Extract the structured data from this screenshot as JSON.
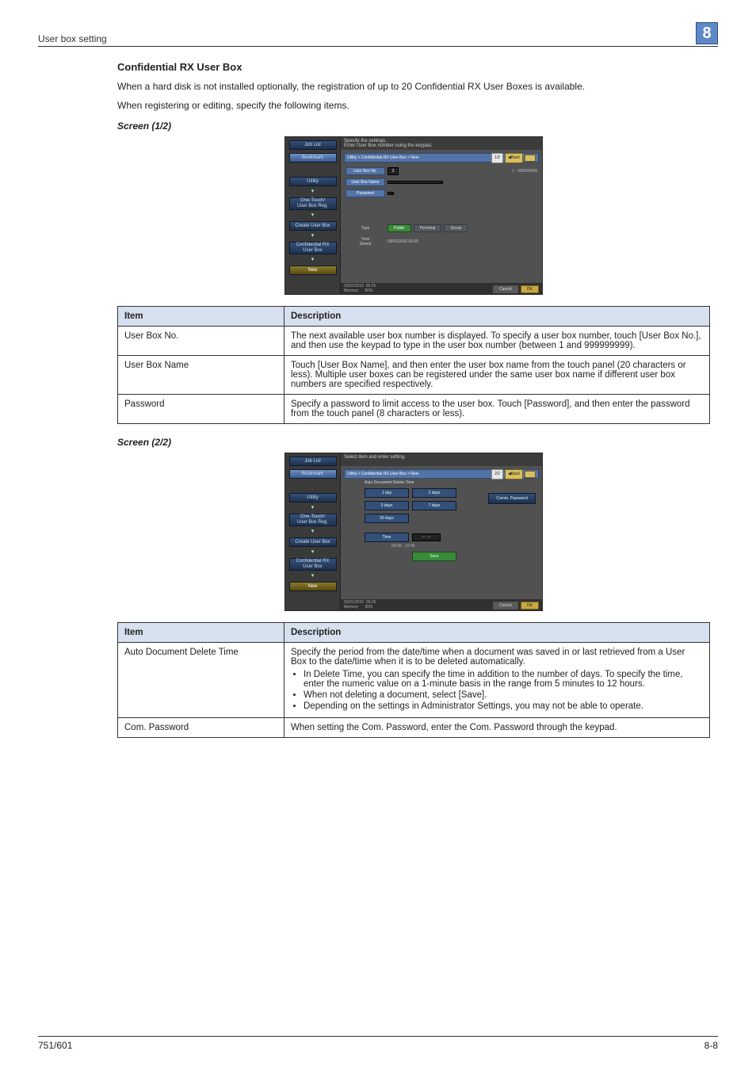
{
  "header": {
    "section": "User box setting",
    "chapter": "8"
  },
  "intro": {
    "heading": "Confidential RX User Box",
    "p1": "When a hard disk is not installed optionally, the registration of up to 20 Confidential RX User Boxes is available.",
    "p2": "When registering or editing, specify the following items."
  },
  "screen1": {
    "title": "Screen (1/2)",
    "top_hint": "Specify the settings.\nEnter User Box number using the keypad.",
    "crumb": "Utility > Confidential RX User Box > New",
    "page": "1/2",
    "back": "Back",
    "fields": {
      "box_no_label": "User Box No.",
      "box_no_value": "3",
      "box_no_range": "1 - 999999999",
      "box_name_label": "User Box Name",
      "password_label": "Password",
      "type_label": "Type",
      "type_opts": {
        "public": "Public",
        "personal": "Personal",
        "group": "Group"
      },
      "stored_label": "Time\nStored",
      "stored_value": "03/01/2010  09:25"
    },
    "footer_time": "03/01/2010  09:25",
    "footer_mem": "Memory      90%",
    "cancel": "Cancel",
    "ok": "OK",
    "sidebar": {
      "joblist": "Job List",
      "bookmark": "Bookmark",
      "utility": "Utility",
      "onetouch": "One-Touch/\nUser Box Reg.",
      "create": "Create User Box",
      "conf": "Confidential RX\nUser Box",
      "new": "New"
    }
  },
  "table1": {
    "h_item": "Item",
    "h_desc": "Description",
    "rows": [
      {
        "item": "User Box No.",
        "desc": "The next available user box number is displayed. To specify a user box number, touch [User Box No.], and then use the keypad to type in the user box number (between 1 and 999999999)."
      },
      {
        "item": "User Box Name",
        "desc": "Touch [User Box Name], and then enter the user box name from the touch panel (20 characters or less). Multiple user boxes can be registered under the same user box name if different user box numbers are specified respectively."
      },
      {
        "item": "Password",
        "desc": "Specify a password to limit access to the user box. Touch [Password], and then enter the password from the touch panel (8 characters or less)."
      }
    ]
  },
  "screen2": {
    "title": "Screen (2/2)",
    "top_hint": "Select item and enter setting.",
    "crumb": "Utility > Confidential RX User Box > New",
    "page": "2/2",
    "back": "Back",
    "panel_title": "Auto Document Delete Time",
    "options": [
      "1 day",
      "2 days",
      "3 days",
      "7 days",
      "30 days"
    ],
    "time_label": "Time",
    "time_value": "-- : --",
    "time_range": "00:05  -  12:00",
    "save": "Save",
    "comm_pw": "Comm. Password",
    "footer_time": "03/01/2010  09:26",
    "footer_mem": "Memory      90%",
    "cancel": "Cancel",
    "ok": "OK"
  },
  "table2": {
    "h_item": "Item",
    "h_desc": "Description",
    "rows": [
      {
        "item": "Auto Document Delete Time",
        "desc_lead": "Specify the period from the date/time when a document was saved in or last retrieved from a User Box to the date/time when it is to be deleted automatically.",
        "bullets": [
          "In Delete Time, you can specify the time in addition to the number of days. To specify the time, enter the numeric value on a 1-minute basis in the range from 5 minutes to 12 hours.",
          "When not deleting a document, select [Save].",
          "Depending on the settings in Administrator Settings, you may not be able to operate."
        ]
      },
      {
        "item": "Com. Password",
        "desc_lead": "When setting the Com. Password, enter the Com. Password through the keypad."
      }
    ]
  },
  "footer": {
    "left": "751/601",
    "right": "8-8"
  }
}
